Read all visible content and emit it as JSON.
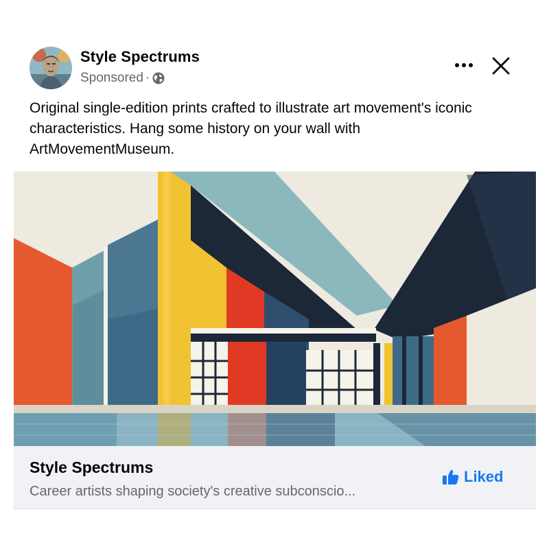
{
  "post": {
    "page_name": "Style Spectrums",
    "sponsored_label": "Sponsored",
    "separator": "·",
    "audience_icon": "globe-icon",
    "more_icon": "more-options-icon",
    "close_icon": "close-icon",
    "text_lines": [
      "Original single-edition prints crafted to illustrate art movement's iconic",
      "characteristics. Hang some history on your wall with",
      "ArtMovementMuseum."
    ]
  },
  "link_preview": {
    "title": "Style Spectrums",
    "subtitle": "Career artists shaping society's creative subconscio...",
    "like_button_label": "Liked",
    "like_icon": "thumbs-up-icon"
  },
  "colors": {
    "accent_blue": "#1877f2",
    "secondary_text": "#65676b",
    "preview_bg": "#f0f2f5",
    "art_orange": "#e4592e",
    "art_yellow": "#f1c232",
    "art_red": "#e03a24",
    "art_teal": "#7fb0b6",
    "art_navy": "#1c2738",
    "art_steel_blue": "#3f6a87",
    "art_cream": "#ece8dd"
  }
}
